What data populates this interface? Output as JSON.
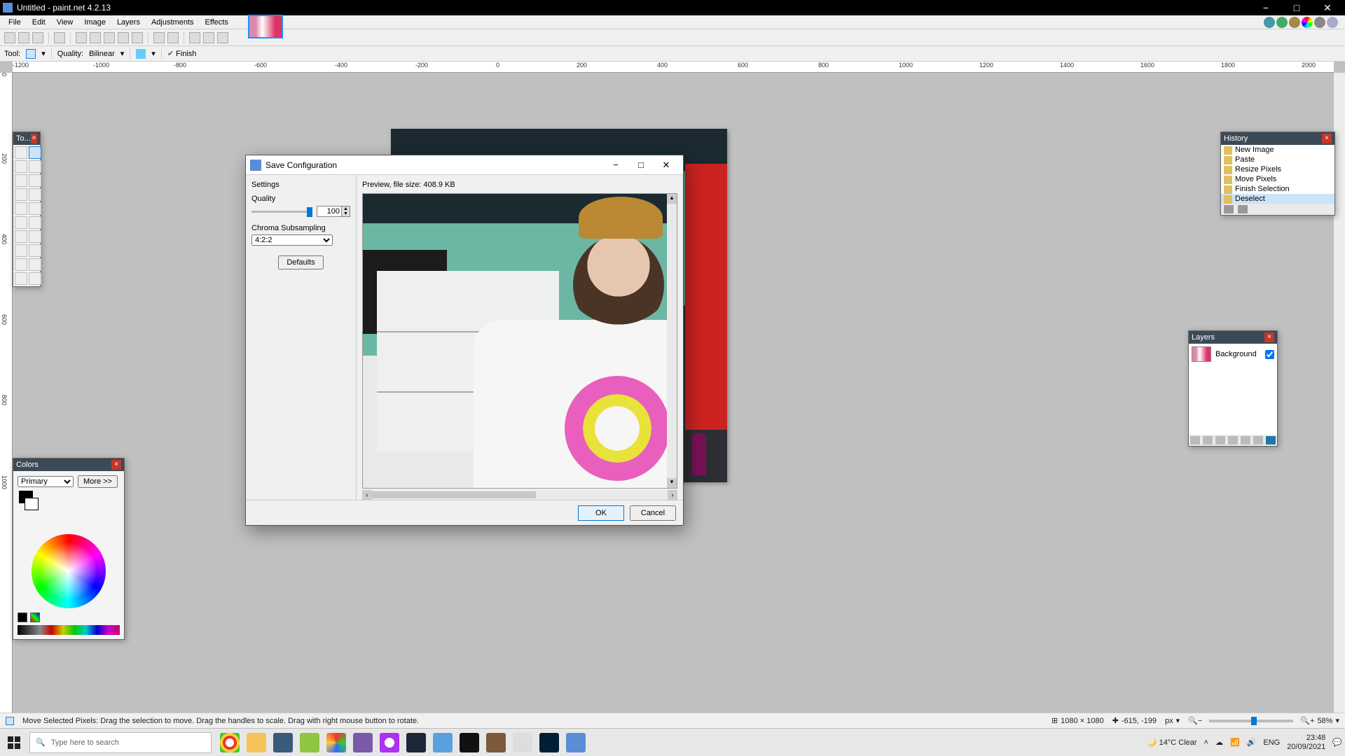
{
  "app": {
    "title": "Untitled - paint.net 4.2.13"
  },
  "menus": [
    "File",
    "Edit",
    "View",
    "Image",
    "Layers",
    "Adjustments",
    "Effects"
  ],
  "tooloptions": {
    "tool_label": "Tool:",
    "quality_label": "Quality:",
    "quality_value": "Bilinear",
    "finish_label": "Finish"
  },
  "ruler_h": [
    "-1200",
    "-1000",
    "-800",
    "-600",
    "-400",
    "-200",
    "0",
    "200",
    "400",
    "600",
    "800",
    "1000",
    "1200",
    "1400",
    "1600",
    "1800",
    "2000"
  ],
  "ruler_v": [
    "0",
    "200",
    "400",
    "600",
    "800",
    "1000"
  ],
  "statusbar": {
    "hint": "Move Selected Pixels: Drag the selection to move. Drag the handles to scale. Drag with right mouse button to rotate.",
    "dimensions": "1080 × 1080",
    "cursor": "-615, -199",
    "unit": "px",
    "zoom": "58%"
  },
  "tools_panel": {
    "title": "To...",
    "selected_index": 1
  },
  "history": {
    "title": "History",
    "items": [
      "New Image",
      "Paste",
      "Resize Pixels",
      "Move Pixels",
      "Finish Selection",
      "Deselect"
    ],
    "selected_index": 5
  },
  "layers": {
    "title": "Layers",
    "rows": [
      {
        "name": "Background",
        "visible": true
      }
    ]
  },
  "colors": {
    "title": "Colors",
    "mode": "Primary",
    "more": "More >>"
  },
  "dialog": {
    "title": "Save Configuration",
    "settings_header": "Settings",
    "quality_label": "Quality",
    "quality_value": "100",
    "chroma_label": "Chroma Subsampling",
    "chroma_value": "4:2:2",
    "defaults": "Defaults",
    "preview_header": "Preview, file size: 408.9 KB",
    "ok": "OK",
    "cancel": "Cancel"
  },
  "taskbar": {
    "search_placeholder": "Type here to search",
    "weather": "14°C  Clear",
    "time": "23:48",
    "date": "20/09/2021"
  }
}
